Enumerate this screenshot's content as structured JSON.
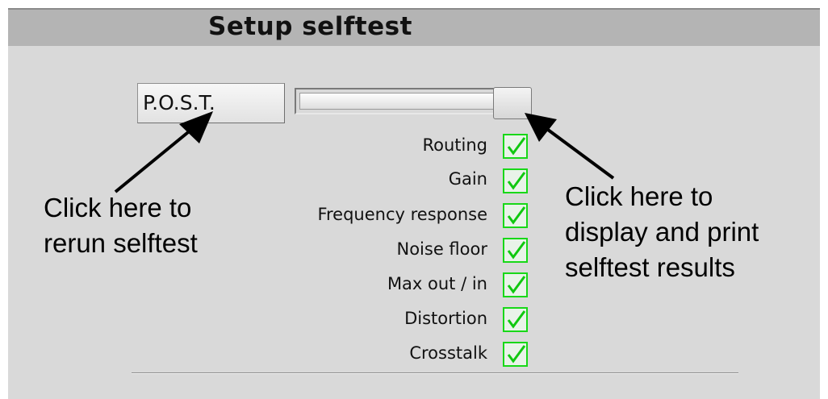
{
  "window": {
    "title": "Setup selftest"
  },
  "controls": {
    "post_button_label": "P.O.S.T.",
    "results_progress": 1.0
  },
  "tests": [
    {
      "label": "Routing",
      "checked": true
    },
    {
      "label": "Gain",
      "checked": true
    },
    {
      "label": "Frequency response",
      "checked": true
    },
    {
      "label": "Noise floor",
      "checked": true
    },
    {
      "label": "Max out / in",
      "checked": true
    },
    {
      "label": "Distortion",
      "checked": true
    },
    {
      "label": "Crosstalk",
      "checked": true
    }
  ],
  "annotations": {
    "left_callout": [
      "Click here to",
      "rerun selftest"
    ],
    "right_callout": [
      "Click here to",
      "display and print",
      "selftest results"
    ]
  },
  "colors": {
    "panel_bg": "#d9d9d9",
    "titlebar_bg": "#b4b4b4",
    "check_border": "#18d818",
    "check_mark": "#10c810"
  },
  "icons": {
    "check": "green-checkmark-icon",
    "arrow": "black-pointer-arrow"
  }
}
